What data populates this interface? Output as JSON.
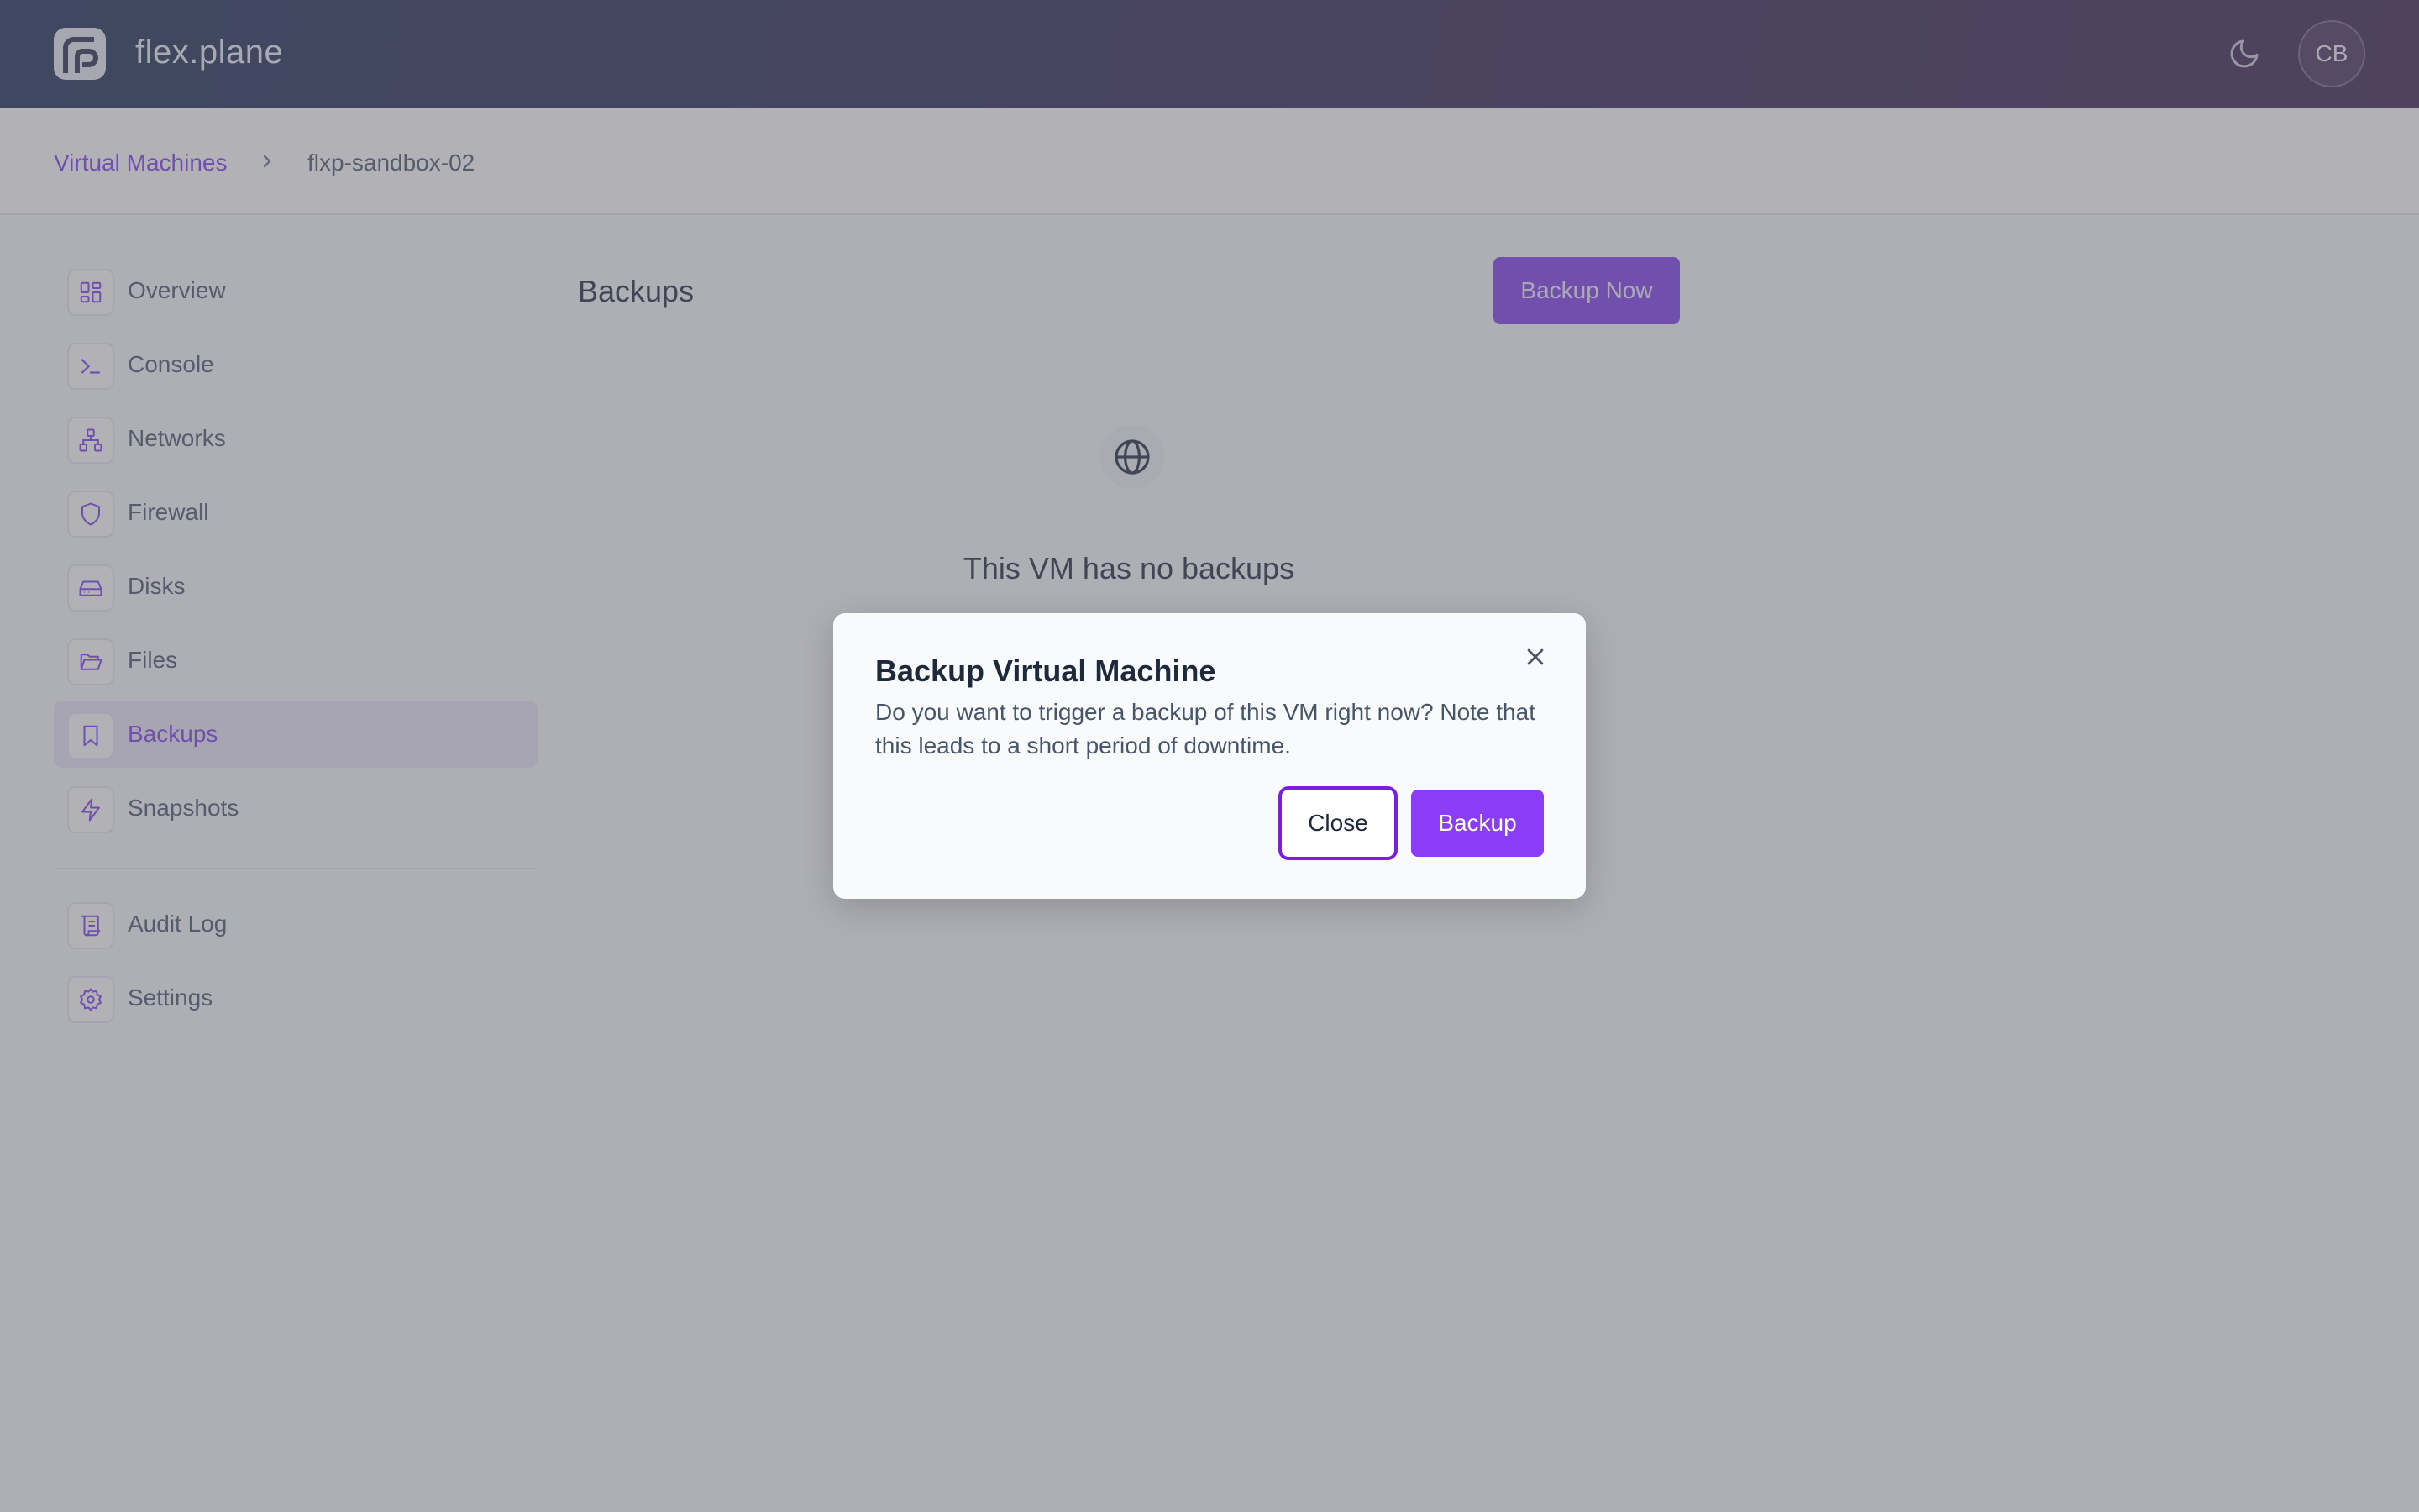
{
  "header": {
    "brand": "flex.plane",
    "logo_icon": "flexplane-logo-icon",
    "theme_icon": "moon-icon",
    "avatar_initials": "CB"
  },
  "breadcrumb": {
    "parent": "Virtual Machines",
    "separator_icon": "chevron-right-icon",
    "current": "flxp-sandbox-02"
  },
  "sidebar": {
    "items": [
      {
        "label": "Overview",
        "icon": "grid-icon",
        "active": false
      },
      {
        "label": "Console",
        "icon": "terminal-icon",
        "active": false
      },
      {
        "label": "Networks",
        "icon": "network-icon",
        "active": false
      },
      {
        "label": "Firewall",
        "icon": "shield-icon",
        "active": false
      },
      {
        "label": "Disks",
        "icon": "hard-drive-icon",
        "active": false
      },
      {
        "label": "Files",
        "icon": "folder-open-icon",
        "active": false
      },
      {
        "label": "Backups",
        "icon": "bookmark-icon",
        "active": true
      },
      {
        "label": "Snapshots",
        "icon": "lightning-icon",
        "active": false
      }
    ],
    "secondary_items": [
      {
        "label": "Audit Log",
        "icon": "scroll-icon"
      },
      {
        "label": "Settings",
        "icon": "gear-icon"
      }
    ]
  },
  "main": {
    "title": "Backups",
    "backup_now_label": "Backup Now",
    "empty_icon": "globe-icon",
    "empty_title": "This VM has no backups"
  },
  "modal": {
    "title": "Backup Virtual Machine",
    "body": "Do you want to trigger a backup of this VM right now? Note that this leads to a short period of downtime.",
    "close_label": "Close",
    "confirm_label": "Backup",
    "close_icon": "close-icon"
  },
  "colors": {
    "accent": "#7c3aed",
    "header_start": "#1a2d52",
    "header_end": "#3c2050",
    "active_bg": "#ece7f6"
  }
}
